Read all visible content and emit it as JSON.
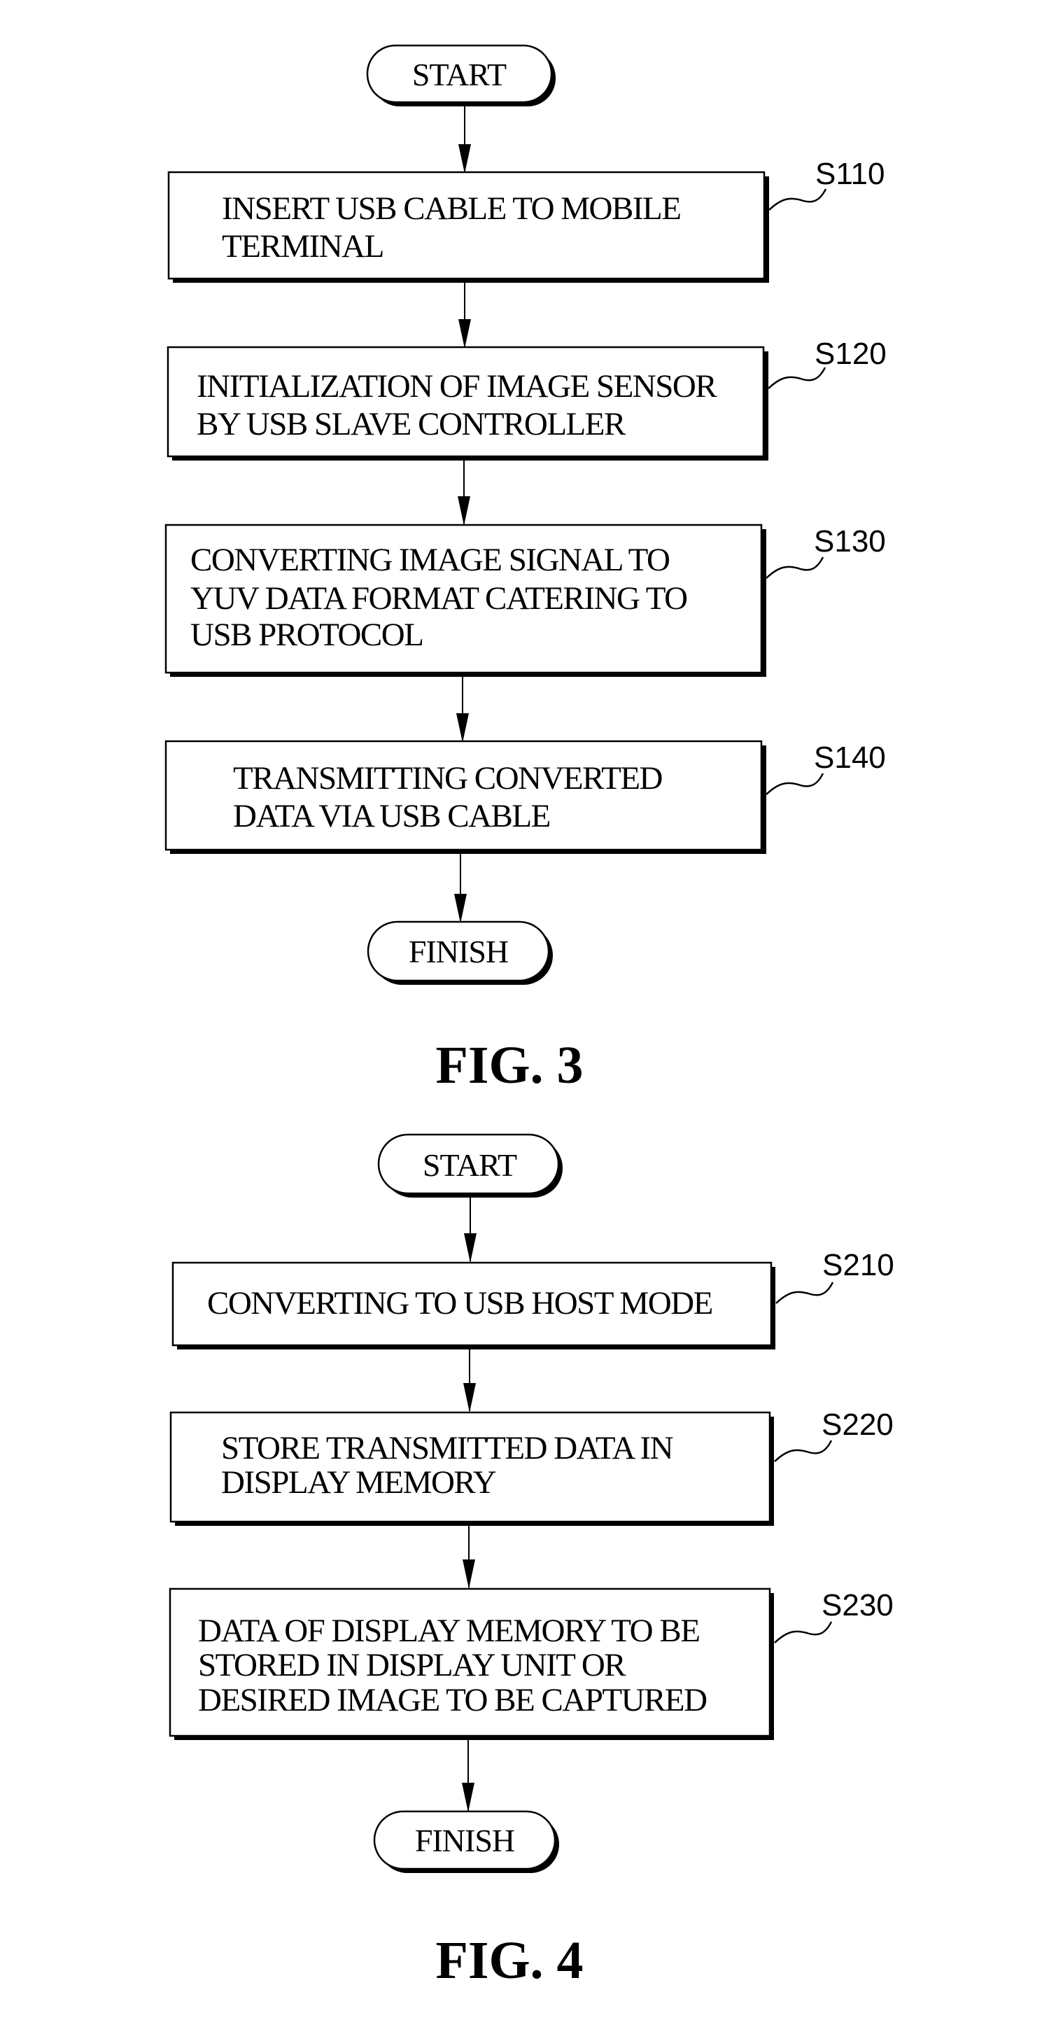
{
  "figures": [
    {
      "caption": "FIG. 3",
      "start_label": "START",
      "finish_label": "FINISH",
      "steps": [
        {
          "ref": "S110",
          "lines": [
            "INSERT USB CABLE TO MOBILE",
            "TERMINAL"
          ]
        },
        {
          "ref": "S120",
          "lines": [
            "INITIALIZATION OF IMAGE SENSOR",
            "BY USB SLAVE CONTROLLER"
          ]
        },
        {
          "ref": "S130",
          "lines": [
            "CONVERTING IMAGE SIGNAL TO",
            "YUV DATA FORMAT CATERING TO",
            "USB PROTOCOL"
          ]
        },
        {
          "ref": "S140",
          "lines": [
            "TRANSMITTING CONVERTED",
            "DATA VIA USB CABLE"
          ]
        }
      ]
    },
    {
      "caption": "FIG. 4",
      "start_label": "START",
      "finish_label": "FINISH",
      "steps": [
        {
          "ref": "S210",
          "lines": [
            "CONVERTING TO USB HOST MODE"
          ]
        },
        {
          "ref": "S220",
          "lines": [
            "STORE TRANSMITTED DATA IN",
            "DISPLAY MEMORY"
          ]
        },
        {
          "ref": "S230",
          "lines": [
            "DATA OF DISPLAY MEMORY TO BE",
            "STORED IN DISPLAY UNIT OR",
            "DESIRED IMAGE TO BE CAPTURED"
          ]
        }
      ]
    }
  ]
}
